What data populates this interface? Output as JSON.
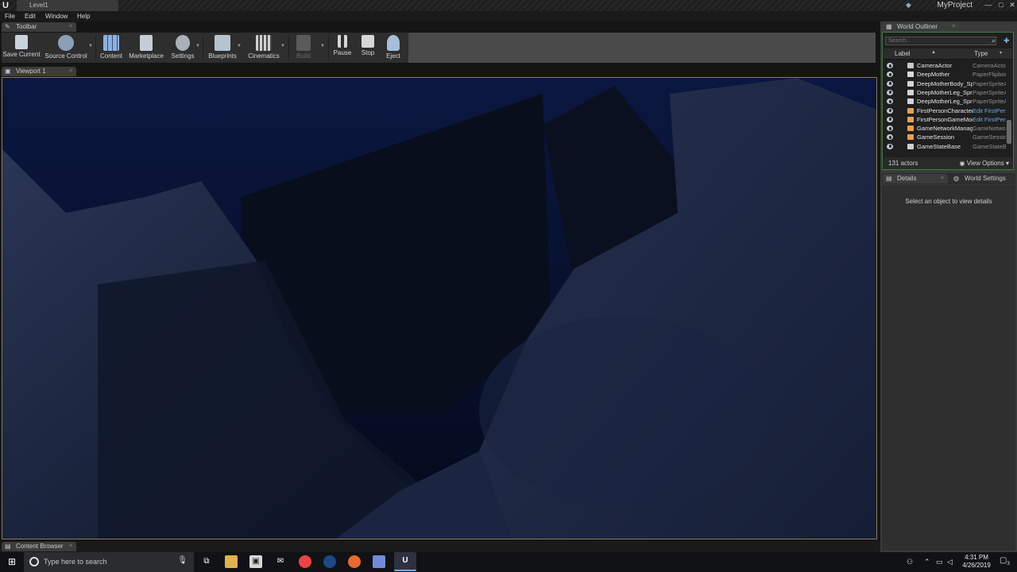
{
  "window": {
    "tab_title": "Level1",
    "project_name": "MyProject",
    "logo_glyph": "U",
    "minimize": "—",
    "maximize": "□",
    "close": "✕"
  },
  "menu": [
    "File",
    "Edit",
    "Window",
    "Help"
  ],
  "panels": {
    "toolbar_tab": "Toolbar",
    "viewport_tab": "Viewport 1",
    "content_browser_tab": "Content Browser",
    "outliner_tab": "World Outliner",
    "details_tab": "Details",
    "world_settings_tab": "World Settings"
  },
  "toolbar": {
    "buttons": [
      {
        "label": "Save Current",
        "icon": "save-icon",
        "color": "#c9d3de"
      },
      {
        "label": "Source Control",
        "icon": "source-control-icon",
        "color": "#8aa0b8"
      },
      {
        "label": "Content",
        "icon": "content-icon",
        "color": "#8fb0e0"
      },
      {
        "label": "Marketplace",
        "icon": "marketplace-icon",
        "color": "#c6cdd6"
      },
      {
        "label": "Settings",
        "icon": "settings-icon",
        "color": "#a9b1bb"
      },
      {
        "label": "Blueprints",
        "icon": "blueprints-icon",
        "color": "#b7c3cf"
      },
      {
        "label": "Cinematics",
        "icon": "cinematics-icon",
        "color": "#d0d0d0"
      },
      {
        "label": "Build",
        "icon": "build-icon",
        "color": "#5a5a5a"
      },
      {
        "label": "Pause",
        "icon": "pause-icon",
        "color": "#d6d6d6"
      },
      {
        "label": "Stop",
        "icon": "stop-icon",
        "color": "#d6d6d6"
      },
      {
        "label": "Eject",
        "icon": "eject-icon",
        "color": "#a7bfd8"
      }
    ]
  },
  "outliner": {
    "search_placeholder": "Search...",
    "col_label": "Label",
    "col_type": "Type",
    "rows": [
      {
        "label": "CameraActor",
        "type": "CameraActor",
        "icon_color": "#c9c9c9",
        "type_link": false
      },
      {
        "label": "DeepMother",
        "type": "PaperFlipbookActor",
        "icon_color": "#d9d9d9",
        "type_link": false
      },
      {
        "label": "DeepMotherBody_Sprite",
        "type": "PaperSpriteActor",
        "icon_color": "#d4d4d4",
        "type_link": false
      },
      {
        "label": "DeepMotherLeg_Sprite",
        "type": "PaperSpriteActor",
        "icon_color": "#d4d4d4",
        "type_link": false
      },
      {
        "label": "DeepMotherLeg_Sprite",
        "type": "PaperSpriteActor",
        "icon_color": "#d4d4d4",
        "type_link": false
      },
      {
        "label": "FirstPersonCharacter",
        "type": "Edit FirstPersonCharacter",
        "icon_color": "#e0a35a",
        "type_link": true
      },
      {
        "label": "FirstPersonGameMode",
        "type": "Edit FirstPersonGameMode",
        "icon_color": "#e0a35a",
        "type_link": true
      },
      {
        "label": "GameNetworkManager",
        "type": "GameNetworkManager",
        "icon_color": "#f0a040",
        "type_link": false
      },
      {
        "label": "GameSession",
        "type": "GameSession",
        "icon_color": "#f0a040",
        "type_link": false
      },
      {
        "label": "GameStateBase",
        "type": "GameStateBase",
        "icon_color": "#d0d0d0",
        "type_link": false
      }
    ],
    "actor_count": "131 actors",
    "view_options": "View Options"
  },
  "details": {
    "hint": "Select an object to view details"
  },
  "taskbar": {
    "search_placeholder": "Type here to search",
    "time": "4:31 PM",
    "date": "4/26/2019",
    "notification_count": "3"
  }
}
